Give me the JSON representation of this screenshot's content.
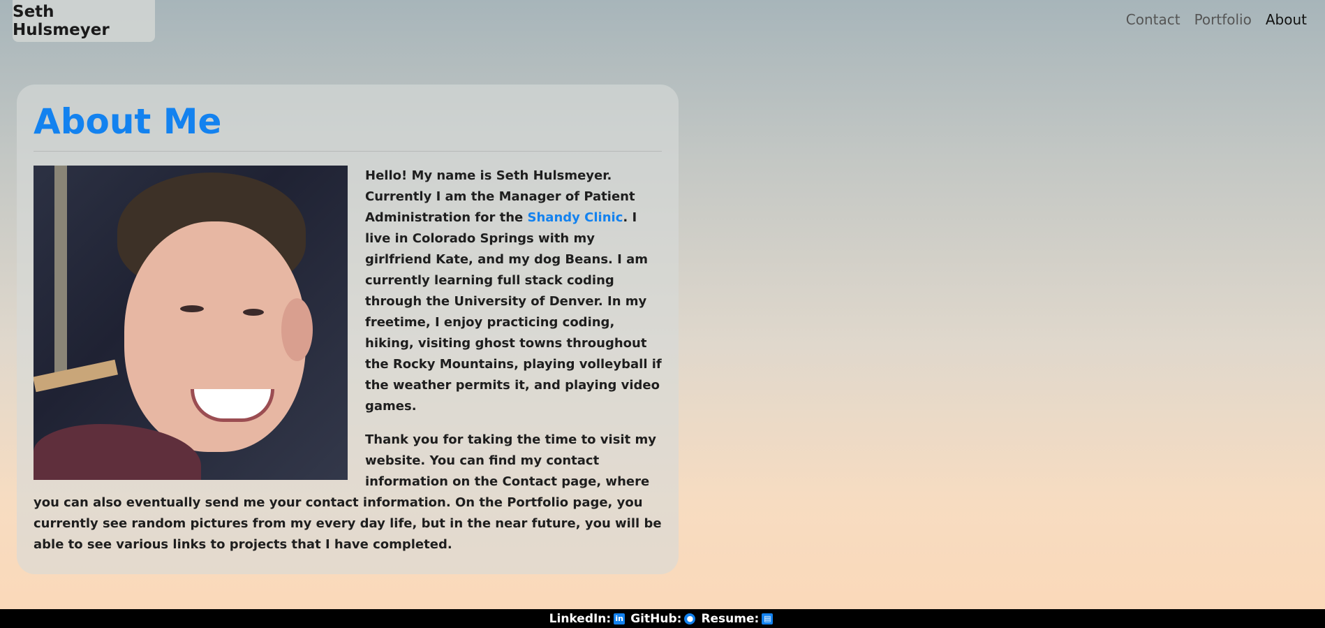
{
  "brand": "Seth Hulsmeyer",
  "nav": [
    {
      "label": "Contact"
    },
    {
      "label": "Portfolio"
    },
    {
      "label": "About"
    }
  ],
  "about": {
    "title": "About Me",
    "p1_before": "Hello! My name is Seth Hulsmeyer. Currently I am the Manager of Patient Administration for the ",
    "p1_link": "Shandy Clinic",
    "p1_after": ". I live in Colorado Springs with my girlfriend Kate, and my dog Beans. I am currently learning full stack coding through the University of Denver. In my freetime, I enjoy practicing coding, hiking, visiting ghost towns throughout the Rocky Mountains, playing volleyball if the weather permits it, and playing video games.",
    "p2": "Thank you for taking the time to visit my website. You can find my contact information on the Contact page, where you can also eventually send me your contact information. On the Portfolio page, you currently see random pictures from my every day life, but in the near future, you will be able to see various links to projects that I have completed."
  },
  "footer": {
    "linkedin_label": "LinkedIn:",
    "linkedin_icon": "linkedin-icon",
    "github_label": "GitHub:",
    "github_icon": "github-icon",
    "resume_label": "Resume:",
    "resume_icon": "pdf-file-icon"
  },
  "colors": {
    "accent": "#1382ef",
    "footer_bg": "#000000"
  }
}
